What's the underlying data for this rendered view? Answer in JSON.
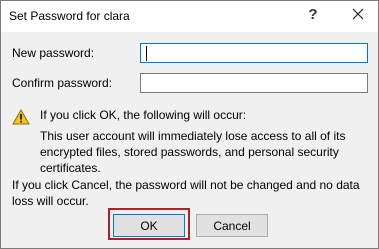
{
  "window": {
    "title": "Set Password for clara",
    "help_glyph": "?",
    "close_icon": "close-icon"
  },
  "form": {
    "new_password_label": "New password:",
    "new_password_value": "",
    "confirm_password_label": "Confirm password:",
    "confirm_password_value": ""
  },
  "warning": {
    "icon": "warning-icon",
    "heading": "If you click OK, the following will occur:",
    "body": "This user account will immediately lose access to all of its encrypted files, stored passwords, and personal security certificates."
  },
  "cancel_note": "If you click Cancel, the password will not be changed and no data loss will occur.",
  "buttons": {
    "ok_label": "OK",
    "cancel_label": "Cancel"
  },
  "colors": {
    "highlight": "#b22222",
    "focus": "#0078d7",
    "warning_yellow": "#f5c518"
  }
}
